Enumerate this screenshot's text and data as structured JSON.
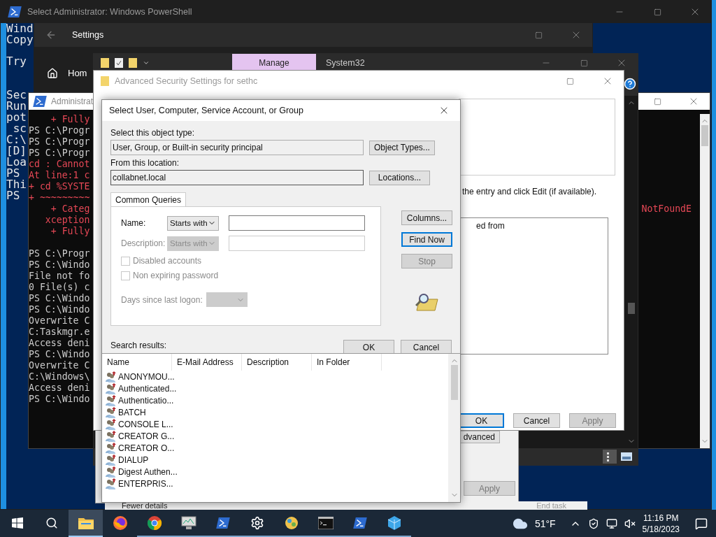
{
  "powershell_back": {
    "title": "Select Administrator: Windows PowerShell",
    "blocks": [
      [
        "Wind",
        "Copy"
      ],
      [
        "Try"
      ],
      [
        "Sec",
        "Run",
        "pot",
        " sc",
        "C:\\",
        "[D]",
        "Loa",
        "PS",
        "Thi",
        "PS"
      ]
    ]
  },
  "settings": {
    "title": "Settings",
    "nav_item": "Hom"
  },
  "powershell_front": {
    "title": "Administrat",
    "fragment": "NotFoundE",
    "blocks": [
      [
        {
          "text": "    + Fully",
          "kind": "error"
        },
        {
          "text": "PS C:\\Progr",
          "kind": "output"
        },
        {
          "text": "PS C:\\Progr",
          "kind": "output"
        },
        {
          "text": "PS C:\\Progr",
          "kind": "output"
        },
        {
          "text": "cd : Cannot",
          "kind": "error"
        },
        {
          "text": "At line:1 c",
          "kind": "error"
        },
        {
          "text": "+ cd %SYSTE",
          "kind": "error"
        },
        {
          "text": "+ ~~~~~~~~~",
          "kind": "error"
        },
        {
          "text": "    + Categ",
          "kind": "error"
        },
        {
          "text": "   xception",
          "kind": "error"
        },
        {
          "text": "    + Fully",
          "kind": "error"
        }
      ],
      [
        {
          "text": "PS C:\\Progr",
          "kind": "output"
        },
        {
          "text": "PS C:\\Windo",
          "kind": "output"
        },
        {
          "text": "File not fo",
          "kind": "output"
        },
        {
          "text": "0 File(s) c",
          "kind": "output"
        },
        {
          "text": "PS C:\\Windo",
          "kind": "output"
        },
        {
          "text": "PS C:\\Windo",
          "kind": "output"
        },
        {
          "text": "Overwrite C",
          "kind": "output"
        },
        {
          "text": "C:Taskmgr.e",
          "kind": "output"
        },
        {
          "text": "Access deni",
          "kind": "output"
        },
        {
          "text": "PS C:\\Windo",
          "kind": "output"
        },
        {
          "text": "Overwrite C",
          "kind": "output"
        },
        {
          "text": "C:\\Windows\\",
          "kind": "output"
        },
        {
          "text": "Access deni",
          "kind": "output"
        },
        {
          "text": "PS C:\\Windo",
          "kind": "output"
        }
      ]
    ]
  },
  "explorer": {
    "title": "System32",
    "context_tab": "Manage"
  },
  "properties": {
    "advanced_button": "dvanced",
    "apply_button": {
      "label": "Apply",
      "disabled": true
    }
  },
  "task_manager": {
    "details_toggle": "Fewer details",
    "end_task": "End task"
  },
  "advanced_security": {
    "title": "Advanced Security Settings for sethc",
    "instruction": "the entry and click Edit (if available).",
    "list_text": "ed from",
    "buttons": [
      {
        "label": "OK",
        "default": true,
        "disabled": false
      },
      {
        "label": "Cancel",
        "default": false,
        "disabled": false
      },
      {
        "label": "Apply",
        "default": false,
        "disabled": true
      }
    ]
  },
  "select_dialog": {
    "title": "Select User, Computer, Service Account, or Group",
    "object_type_label": "Select this object type:",
    "object_type": "User, Group, or Built-in security principal",
    "object_types_button": "Object Types...",
    "location_label": "From this location:",
    "location": "collabnet.local",
    "locations_button": "Locations...",
    "tab": {
      "label": "Common Queries",
      "selected": true
    },
    "queries": [
      {
        "label": "Name:",
        "mode": "Starts with",
        "disabled": false
      },
      {
        "label": "Description:",
        "mode": "Starts with",
        "disabled": true
      }
    ],
    "checkboxes": [
      {
        "label": "Disabled accounts",
        "checked": false,
        "disabled": true
      },
      {
        "label": "Non expiring password",
        "checked": false,
        "disabled": true
      }
    ],
    "days_label": "Days since last logon:",
    "days_disabled": true,
    "side_buttons": [
      {
        "label": "Columns...",
        "default": false,
        "disabled": false
      },
      {
        "label": "Find Now",
        "default": true,
        "disabled": false
      },
      {
        "label": "Stop",
        "default": false,
        "disabled": true
      }
    ],
    "buttons": [
      "OK",
      "Cancel"
    ],
    "results_label": "Search results:",
    "columns": [
      "Name",
      "E-Mail Address",
      "Description",
      "In Folder"
    ],
    "rows": [
      "ANONYMOU...",
      "Authenticated...",
      "Authenticatio...",
      "BATCH",
      "CONSOLE L...",
      "CREATOR G...",
      "CREATOR O...",
      "DIALUP",
      "Digest Authen...",
      "ENTERPRIS..."
    ]
  },
  "taskbar": {
    "apps": [
      {
        "kind": "start",
        "selected": false,
        "running": false
      },
      {
        "kind": "search",
        "selected": false,
        "running": false
      },
      {
        "kind": "explorer",
        "selected": true,
        "running": true
      },
      {
        "kind": "firefox",
        "selected": false,
        "running": false
      },
      {
        "kind": "chrome",
        "selected": false,
        "running": true
      },
      {
        "kind": "monitor",
        "selected": false,
        "running": true
      },
      {
        "kind": "powershell",
        "selected": false,
        "running": true
      },
      {
        "kind": "settings",
        "selected": false,
        "running": true
      },
      {
        "kind": "paint",
        "selected": false,
        "running": true
      },
      {
        "kind": "terminal",
        "selected": false,
        "running": true
      },
      {
        "kind": "powershell",
        "selected": false,
        "running": true
      },
      {
        "kind": "cluster",
        "selected": false,
        "running": true
      }
    ],
    "temperature": "51°F",
    "time": "11:16 PM",
    "date": "5/18/2023"
  }
}
